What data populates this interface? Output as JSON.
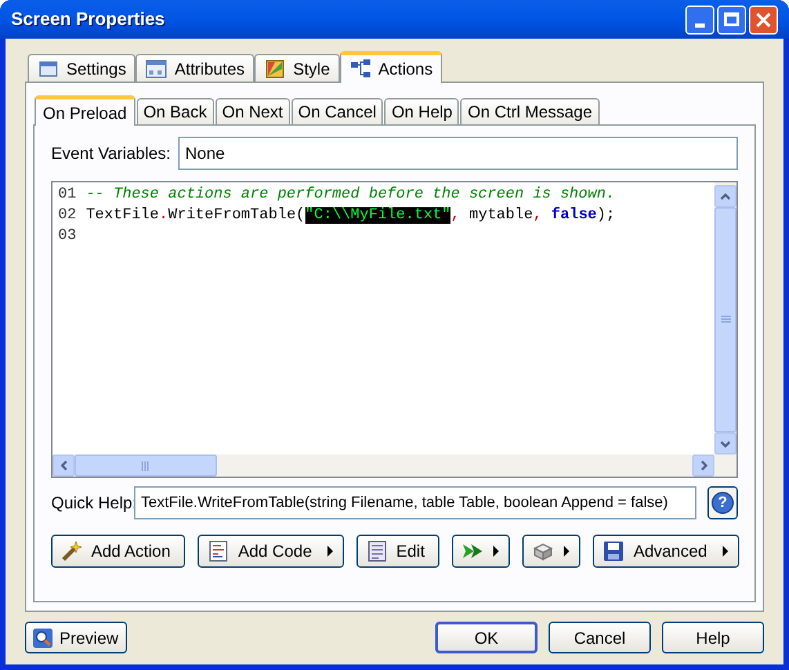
{
  "window": {
    "title": "Screen Properties"
  },
  "tabs": [
    {
      "label": "Settings",
      "kind": "settings",
      "selected": false
    },
    {
      "label": "Attributes",
      "kind": "attributes",
      "selected": false
    },
    {
      "label": "Style",
      "kind": "style",
      "selected": false
    },
    {
      "label": "Actions",
      "kind": "actions",
      "selected": true
    }
  ],
  "event_tabs": [
    {
      "label": "On Preload",
      "selected": true
    },
    {
      "label": "On Back",
      "selected": false
    },
    {
      "label": "On Next",
      "selected": false
    },
    {
      "label": "On Cancel",
      "selected": false
    },
    {
      "label": "On Help",
      "selected": false
    },
    {
      "label": "On Ctrl Message",
      "selected": false
    }
  ],
  "event_variables": {
    "label": "Event Variables:",
    "value": "None"
  },
  "code": [
    {
      "number": "01",
      "tokens": [
        {
          "kind": "comment",
          "text": "-- These actions are performed before the screen is shown.",
          "selected": false
        }
      ]
    },
    {
      "number": "02",
      "tokens": [
        {
          "kind": "plain",
          "text": "TextFile",
          "selected": false
        },
        {
          "kind": "punct",
          "text": ".",
          "selected": false
        },
        {
          "kind": "plain",
          "text": "WriteFromTable(",
          "selected": false
        },
        {
          "kind": "string",
          "text": "\"C:\\\\MyFile.txt\"",
          "selected": true
        },
        {
          "kind": "punct",
          "text": ",",
          "selected": false
        },
        {
          "kind": "plain",
          "text": " mytable",
          "selected": false
        },
        {
          "kind": "punct",
          "text": ", ",
          "selected": false
        },
        {
          "kind": "keyword",
          "text": "false",
          "selected": false
        },
        {
          "kind": "plain",
          "text": ");",
          "selected": false
        }
      ]
    },
    {
      "number": "03"
    }
  ],
  "quick_help": {
    "label": "Quick Help:",
    "value": "TextFile.WriteFromTable(string Filename, table Table, boolean Append = false)",
    "button": "?"
  },
  "action_buttons": [
    {
      "label": "Add Action",
      "kind": "wand",
      "menu": false
    },
    {
      "label": "Add Code",
      "kind": "code",
      "menu": true
    },
    {
      "label": "Edit",
      "kind": "edit",
      "menu": false
    },
    {
      "kind": "arrow",
      "menu": true
    },
    {
      "kind": "box",
      "menu": true
    },
    {
      "label": "Advanced",
      "kind": "disk",
      "menu": true
    }
  ],
  "preview": {
    "label": "Preview"
  },
  "buttons": [
    {
      "label": "OK",
      "default": true
    },
    {
      "label": "Cancel",
      "default": false
    },
    {
      "label": "Help",
      "default": false
    }
  ]
}
